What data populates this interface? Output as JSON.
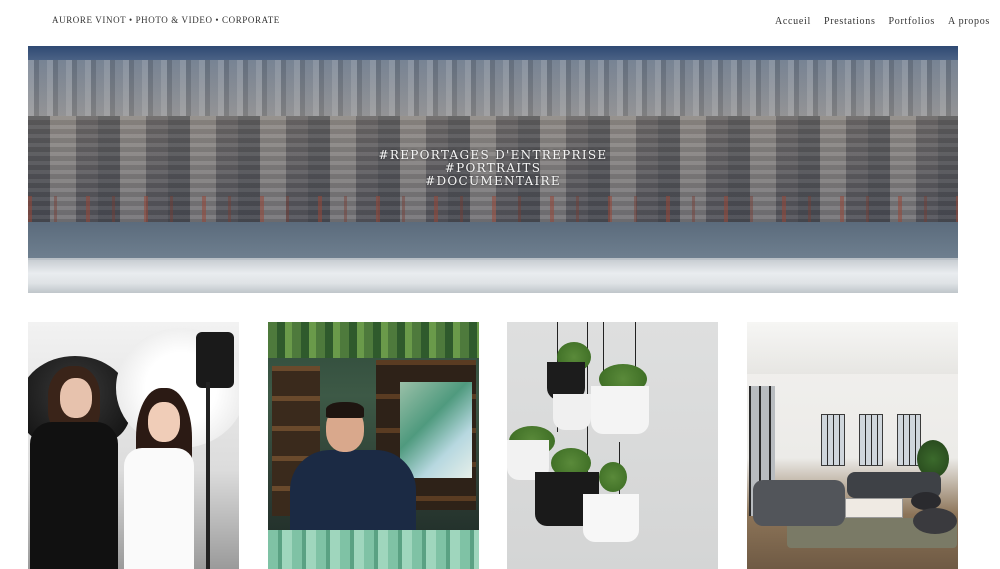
{
  "header": {
    "brand": "AURORE VINOT • PHOTO & VIDEO • CORPORATE",
    "nav": [
      "Accueil",
      "Prestations",
      "Portfolios",
      "A propos"
    ]
  },
  "hero": {
    "tagline": [
      "#REPORTAGES D'ENTREPRISE",
      "#PORTRAITS",
      "#DOCUMENTAIRE"
    ]
  },
  "colors": {
    "background": "#ffffff",
    "text": "#333333",
    "hero_text": "#f6f6f6"
  }
}
